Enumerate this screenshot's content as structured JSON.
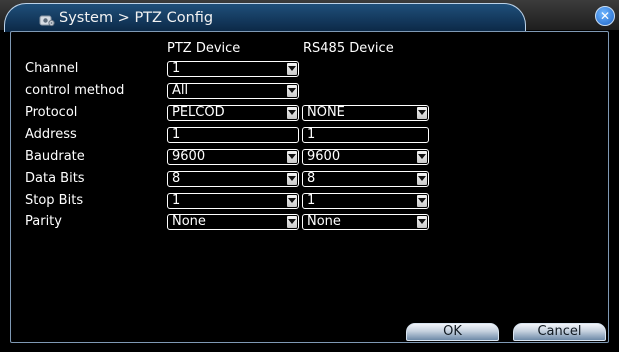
{
  "window": {
    "title": "System > PTZ Config",
    "title_icon": "gear-icon",
    "close_icon": "close-icon",
    "close_glyph": "✕"
  },
  "columns": {
    "ptz": "PTZ Device",
    "rs485": "RS485 Device"
  },
  "rows": {
    "channel": {
      "label": "Channel",
      "ptz": "1"
    },
    "control_method": {
      "label": "control method",
      "ptz": "All"
    },
    "protocol": {
      "label": "Protocol",
      "ptz": "PELCOD",
      "rs485": "NONE"
    },
    "address": {
      "label": "Address",
      "ptz": "1",
      "rs485": "1"
    },
    "baudrate": {
      "label": "Baudrate",
      "ptz": "9600",
      "rs485": "9600"
    },
    "data_bits": {
      "label": "Data Bits",
      "ptz": "8",
      "rs485": "8"
    },
    "stop_bits": {
      "label": "Stop Bits",
      "ptz": "1",
      "rs485": "1"
    },
    "parity": {
      "label": "Parity",
      "ptz": "None",
      "rs485": "None"
    }
  },
  "buttons": {
    "ok": "OK",
    "cancel": "Cancel"
  }
}
